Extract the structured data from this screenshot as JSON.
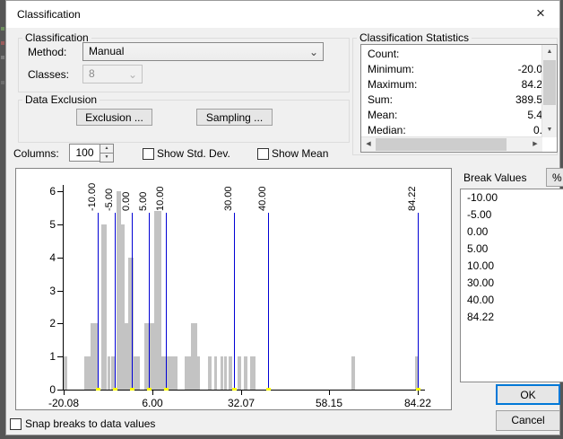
{
  "dialog": {
    "title": "Classification",
    "close_icon": "×"
  },
  "classification_group": {
    "label": "Classification",
    "method_label": "Method:",
    "method_value": "Manual",
    "classes_label": "Classes:",
    "classes_value": "8",
    "chevron_icon": "⌄"
  },
  "data_exclusion_group": {
    "label": "Data Exclusion",
    "exclusion_button": "Exclusion ...",
    "sampling_button": "Sampling ..."
  },
  "columns": {
    "label": "Columns:",
    "value": "100"
  },
  "checkboxes": {
    "show_std_dev": "Show Std. Dev.",
    "show_mean": "Show Mean",
    "snap_breaks": "Snap breaks to data values"
  },
  "statistics": {
    "label": "Classification Statistics",
    "rows": [
      {
        "name": "Count:",
        "value": ""
      },
      {
        "name": "Minimum:",
        "value": "-20.0"
      },
      {
        "name": "Maximum:",
        "value": "84.2"
      },
      {
        "name": "Sum:",
        "value": "389.5"
      },
      {
        "name": "Mean:",
        "value": "5.4"
      },
      {
        "name": "Median:",
        "value": "0."
      }
    ]
  },
  "break_values": {
    "label": "Break Values",
    "percent_button": "%",
    "values": [
      "-10.00",
      "-5.00",
      "0.00",
      "5.00",
      "10.00",
      "30.00",
      "40.00",
      "84.22"
    ]
  },
  "actions": {
    "ok": "OK",
    "cancel": "Cancel"
  },
  "chart_data": {
    "type": "bar",
    "title": "",
    "xlabel": "",
    "ylabel": "",
    "xlim": [
      -20.08,
      84.22
    ],
    "ylim": [
      0,
      6
    ],
    "grid": false,
    "x_tick_values": [
      -20.08,
      6.0,
      32.07,
      58.15,
      84.22
    ],
    "x_tick_labels": [
      "-20.08",
      "6.00",
      "32.07",
      "58.15",
      "84.22"
    ],
    "y_tick_values": [
      0,
      1,
      2,
      3,
      4,
      5,
      6
    ],
    "bar_color": "#c3c3c3",
    "bars": [
      [
        -20.1,
        -19.0,
        1
      ],
      [
        -14.0,
        -12.2,
        1
      ],
      [
        -12.2,
        -10.0,
        2
      ],
      [
        -9.0,
        -7.5,
        5
      ],
      [
        -7.1,
        -6.3,
        1
      ],
      [
        -6.0,
        -5.0,
        1
      ],
      [
        -4.5,
        -3.2,
        6
      ],
      [
        -3.2,
        -2.1,
        5
      ],
      [
        -2.1,
        -1.1,
        2
      ],
      [
        -1.1,
        0.5,
        4
      ],
      [
        0.5,
        2.4,
        1
      ],
      [
        3.7,
        6.6,
        2
      ],
      [
        6.6,
        8.7,
        5.4
      ],
      [
        8.7,
        10.0,
        1
      ],
      [
        10.3,
        13.5,
        1
      ],
      [
        15.6,
        17.4,
        1
      ],
      [
        17.4,
        19.3,
        2
      ],
      [
        19.3,
        20.1,
        1
      ],
      [
        22.4,
        23.5,
        1
      ],
      [
        24.3,
        25.1,
        1
      ],
      [
        26.1,
        26.9,
        1
      ],
      [
        27.2,
        28.0,
        1
      ],
      [
        28.5,
        29.5,
        1
      ],
      [
        31.1,
        32.2,
        1
      ],
      [
        33.0,
        34.0,
        1
      ],
      [
        34.8,
        36.4,
        1
      ],
      [
        64.7,
        65.8,
        1
      ],
      [
        83.3,
        84.5,
        1
      ]
    ],
    "break_lines": {
      "values": [
        -10,
        -5,
        0,
        5,
        10,
        30,
        40,
        84.22
      ],
      "labels": [
        "-10.00",
        "-5.00",
        "0.00",
        "5.00",
        "10.00",
        "30.00",
        "40.00",
        "84.22"
      ],
      "top": 5.35,
      "color": "#0000d4",
      "handle_color": "#ffff00"
    }
  }
}
